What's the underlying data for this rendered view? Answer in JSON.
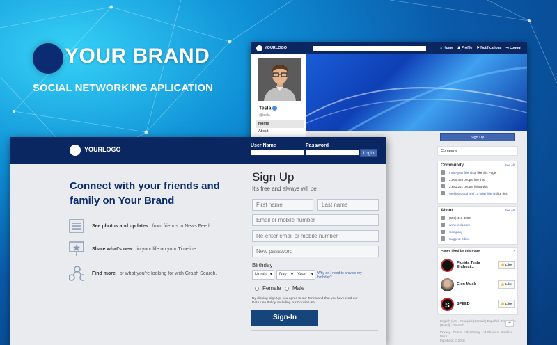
{
  "brand": {
    "title": "YOUR BRAND",
    "subtitle": "SOCIAL NETWORKING APLICATION",
    "accent": "#0b2b73"
  },
  "profile_window": {
    "nav": {
      "logo": "YOURLOGO",
      "links": [
        "Home",
        "Profile",
        "Notifications",
        "Logout"
      ]
    },
    "profile": {
      "name": "Tesla",
      "handle": "@tesla",
      "menu": [
        "Home",
        "About"
      ]
    },
    "sign_up_button": "Sign Up",
    "category": "Company",
    "community": {
      "title": "Community",
      "see_all": "See All",
      "rows": [
        {
          "link": "Invite your friends",
          "text": " to like this Page"
        },
        {
          "link": "",
          "text": "2,860,469 people like this"
        },
        {
          "link": "",
          "text": "2,881,251 people follow this"
        },
        {
          "link": "Weldon Dodd and 15 other friends",
          "text": " like this"
        }
      ]
    },
    "about": {
      "title": "About",
      "see_all": "See All",
      "rows": [
        "(650) 413-4000",
        "www.tesla.com",
        "Company",
        "Suggest Edits"
      ]
    },
    "liked_pages": {
      "title": "Pages liked by this Page",
      "items": [
        {
          "name": "Florida Tesla Enthusi...",
          "like": "Like"
        },
        {
          "name": "Elon Musk",
          "like": "Like"
        },
        {
          "name": "SPEED",
          "like": "Like"
        }
      ]
    },
    "footer": {
      "languages": "English (US) · Français (Canada) Español · Português (Brasil) · Deutsch",
      "links": "Privacy · Terms · Advertising · Ad Choices · Cookies · More",
      "copyright": "Facebook © 2018"
    }
  },
  "signup_window": {
    "nav": {
      "logo": "YOURLOGO",
      "user_label": "User Name",
      "password_label": "Password",
      "login": "Login"
    },
    "headline": "Connect with your friends and family on Your Brand",
    "features": [
      {
        "bold": "See photos and updates",
        "text": "from friends in News Feed."
      },
      {
        "bold": "Share what's new",
        "text": "in your life on your Timeline."
      },
      {
        "bold": "Find more",
        "text": "of what you're looking for with Graph Search."
      }
    ],
    "form": {
      "title": "Sign Up",
      "subtitle": "It's free and always will be.",
      "first_name": "First name",
      "last_name": "Last name",
      "email": "Email or mobile number",
      "reenter": "Re-enter email or mobile number",
      "password": "New password",
      "birthday": "Birthday",
      "month": "Month",
      "day": "Day",
      "year": "Year",
      "why": "Why do I need to provide my birthday?",
      "female": "Female",
      "male": "Male",
      "terms": "By clicking Sign Up, you agree to our Terms and that you have read our Data Use Policy, including our Cookie Use.",
      "submit": "Sign-In"
    }
  }
}
